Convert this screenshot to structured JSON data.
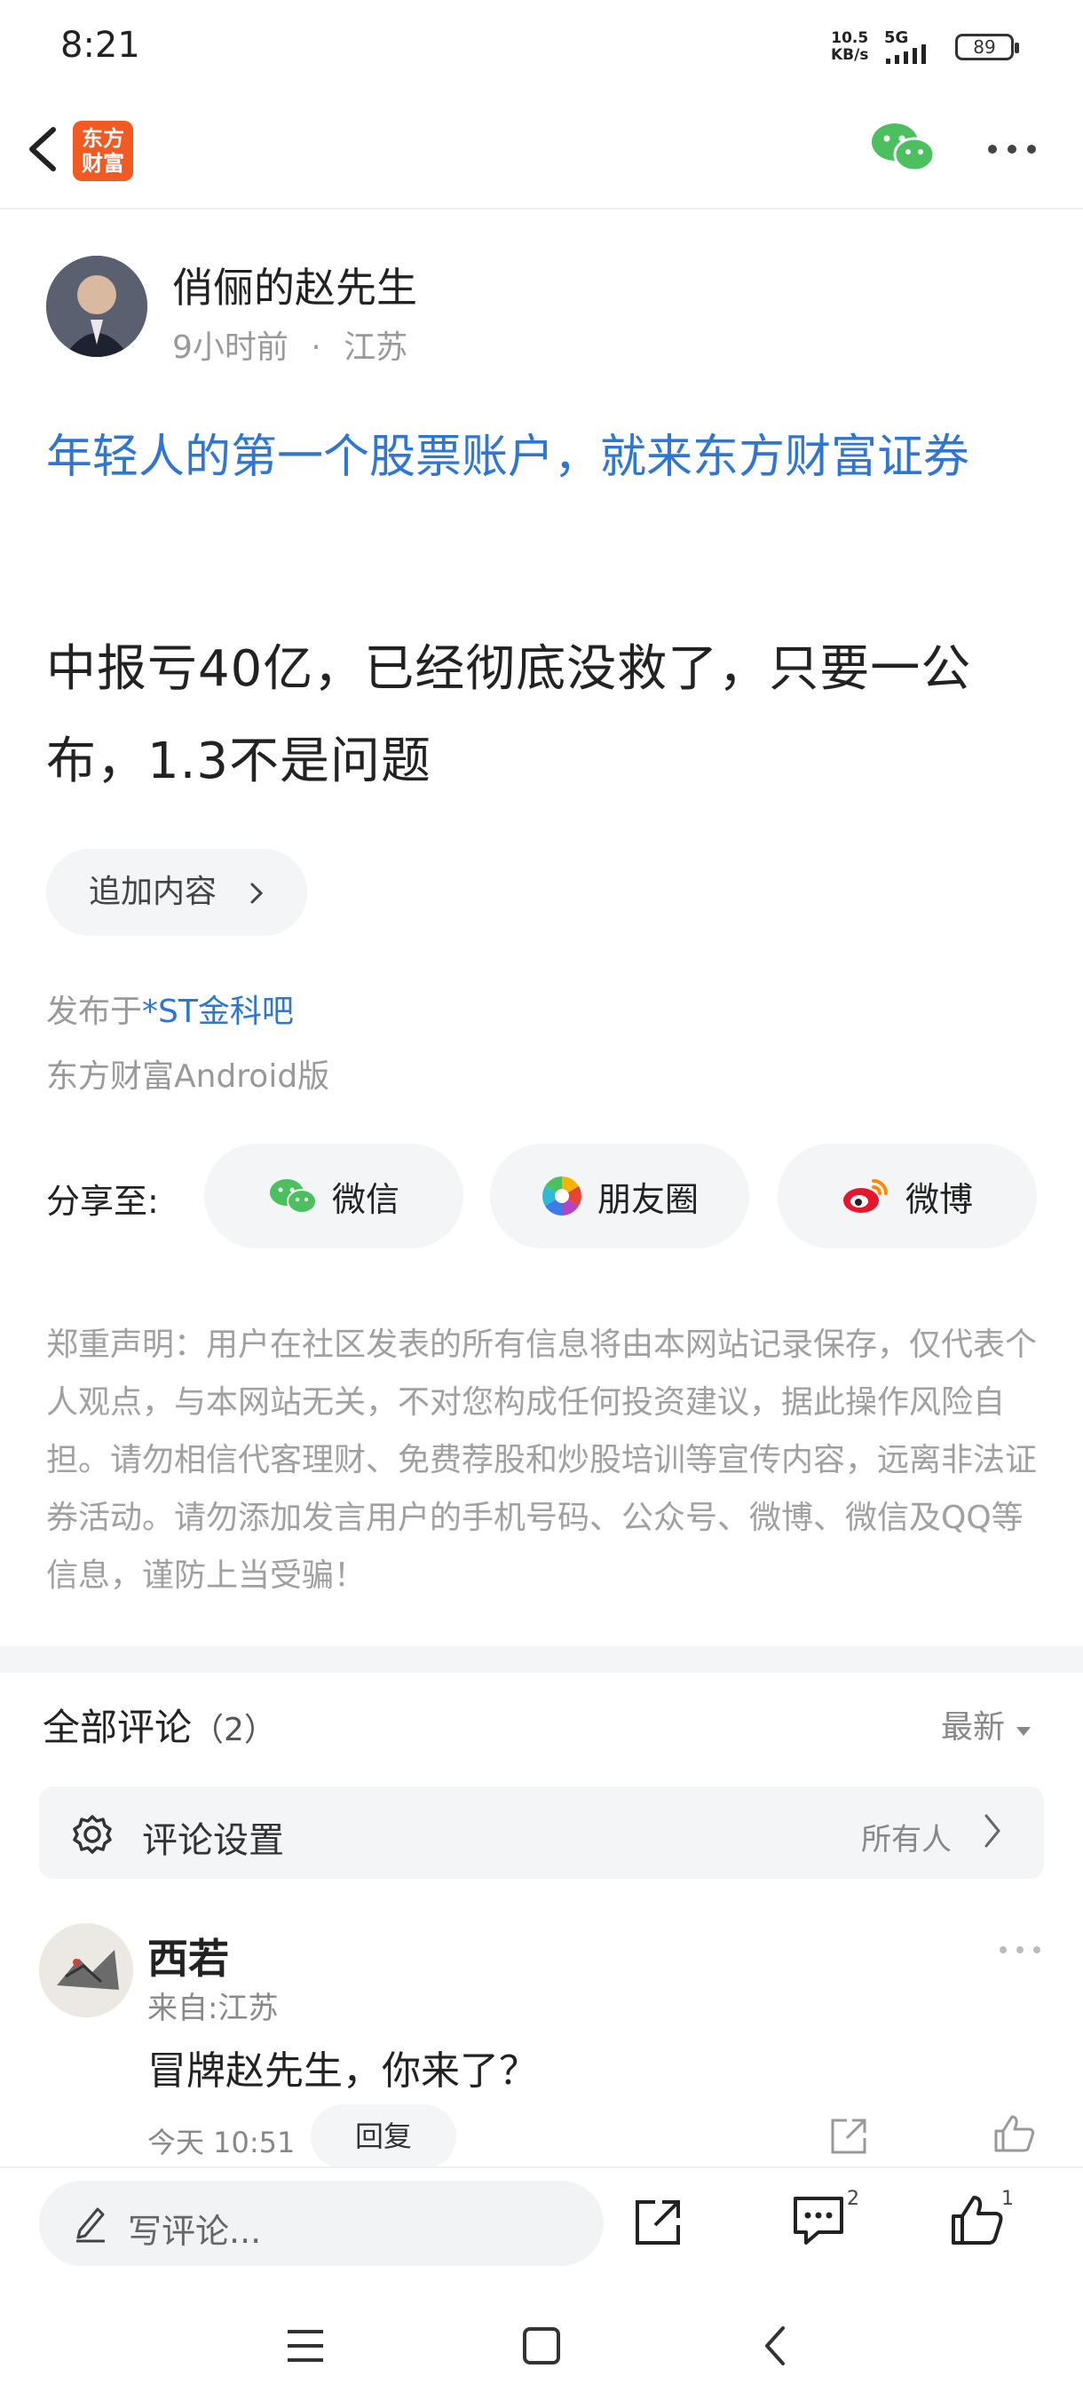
{
  "status_bar": {
    "time": "8:21",
    "net_speed_value": "10.5",
    "net_speed_unit": "KB/s",
    "network": "5G",
    "battery": "89"
  },
  "top_bar": {
    "logo_line1": "东方",
    "logo_line2": "财富"
  },
  "author": {
    "name": "俏俪的赵先生",
    "time_ago": "9小时前",
    "separator": "·",
    "location": "江苏"
  },
  "ad_title": "年轻人的第一个股票账户，就来东方财富证券",
  "post_body": "中报亏40亿，已经彻底没救了，只要一公布，1.3不是问题",
  "append_button": "追加内容",
  "published_prefix": "发布于",
  "published_forum": "*ST金科吧",
  "platform": "东方财富Android版",
  "share": {
    "label": "分享至:",
    "targets": [
      {
        "label": "微信",
        "icon": "wechat-icon"
      },
      {
        "label": "朋友圈",
        "icon": "moments-icon"
      },
      {
        "label": "微博",
        "icon": "weibo-icon"
      }
    ]
  },
  "disclaimer": "郑重声明：用户在社区发表的所有信息将由本网站记录保存，仅代表个人观点，与本网站无关，不对您构成任何投资建议，据此操作风险自担。请勿相信代客理财、免费荐股和炒股培训等宣传内容，远离非法证券活动。请勿添加发言用户的手机号码、公众号、微博、微信及QQ等信息，谨防上当受骗！",
  "comments": {
    "title": "全部评论",
    "count": "（2）",
    "sort_label": "最新",
    "settings_label": "评论设置",
    "settings_value": "所有人",
    "items": [
      {
        "user": "西若",
        "from": "来自:江苏",
        "text": "冒牌赵先生，你来了？",
        "time": "今天 10:51",
        "reply_label": "回复"
      }
    ]
  },
  "bottom_bar": {
    "write_placeholder": "写评论...",
    "comment_count": "2",
    "like_count": "1"
  },
  "colors": {
    "link_blue": "#2f76d2",
    "brand_orange": "#f15a22",
    "wechat_green": "#4cbf5f",
    "muted_gray": "#999999",
    "pill_bg": "#f4f5f7"
  }
}
